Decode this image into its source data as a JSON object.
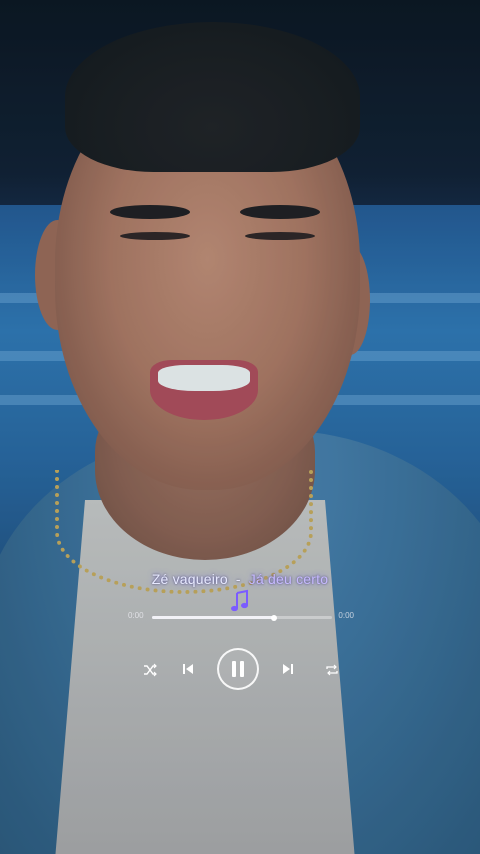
{
  "player": {
    "artist": "Zé vaqueiro",
    "separator": "-",
    "song": "Já deu certo",
    "progress_fraction": 0.68,
    "icons": {
      "note": "music-note-icon",
      "shuffle": "shuffle-icon",
      "previous": "previous-icon",
      "pause": "pause-icon",
      "next": "next-icon",
      "repeat": "repeat-icon"
    }
  },
  "colors": {
    "title": "#e7e9ff",
    "song": "#c6b9ff",
    "note": "#7b5cff",
    "controls": "#ffffff"
  }
}
